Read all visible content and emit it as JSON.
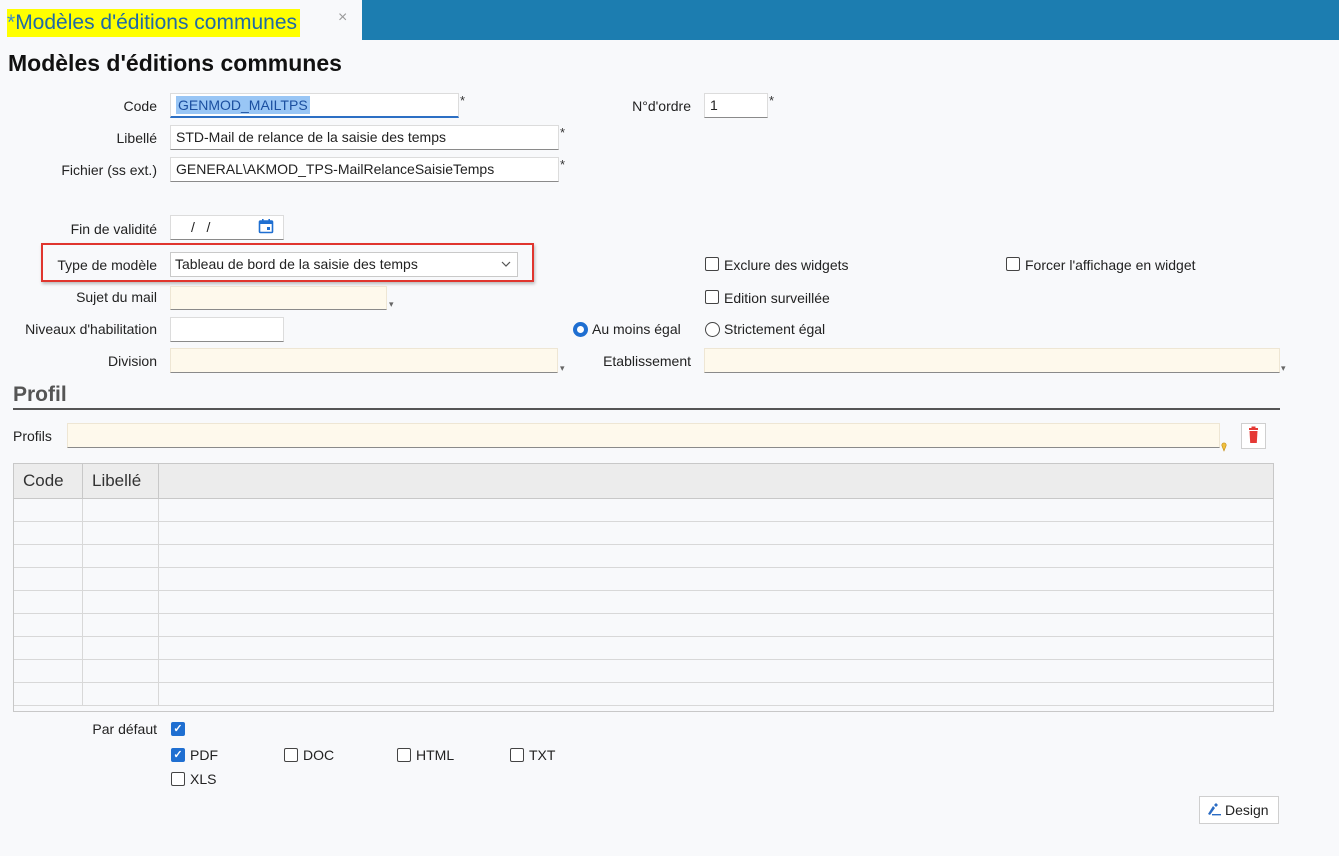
{
  "tab": {
    "modified_mark": "*",
    "title": "Modèles d'éditions communes",
    "close": "×"
  },
  "page_title": "Modèles d'éditions communes",
  "form": {
    "code": {
      "label": "Code",
      "value": "GENMOD_MAILTPS",
      "required": "*"
    },
    "ordre": {
      "label": "N°d'ordre",
      "value": "1",
      "required": "*"
    },
    "libelle": {
      "label": "Libellé",
      "value": "STD-Mail de relance de la saisie des temps",
      "required": "*"
    },
    "fichier": {
      "label": "Fichier (ss ext.)",
      "value": "GENERAL\\AKMOD_TPS-MailRelanceSaisieTemps",
      "required": "*"
    },
    "fin_validite": {
      "label": "Fin de validité",
      "value": "/   /"
    },
    "type_modele": {
      "label": "Type de modèle",
      "value": "Tableau de bord de la saisie des temps"
    },
    "sujet_mail": {
      "label": "Sujet du mail",
      "value": ""
    },
    "niveaux": {
      "label": "Niveaux d'habilitation",
      "value": ""
    },
    "division": {
      "label": "Division",
      "value": ""
    },
    "etablissement": {
      "label": "Etablissement",
      "value": ""
    },
    "exclure_widgets": {
      "label": "Exclure des widgets",
      "checked": false
    },
    "forcer_widget": {
      "label": "Forcer l'affichage en widget",
      "checked": false
    },
    "edition_surveillee": {
      "label": "Edition surveillée",
      "checked": false
    },
    "au_moins_egal": {
      "label": "Au moins égal",
      "selected": true
    },
    "strictement_egal": {
      "label": "Strictement égal",
      "selected": false
    }
  },
  "profil": {
    "section_title": "Profil",
    "profils_label": "Profils",
    "profils_value": "",
    "grid_columns": [
      "Code",
      "Libellé"
    ],
    "grid_rows": 9
  },
  "defaults": {
    "par_defaut_label": "Par défaut",
    "par_defaut_checked": true,
    "formats": [
      {
        "label": "PDF",
        "checked": true
      },
      {
        "label": "DOC",
        "checked": false
      },
      {
        "label": "HTML",
        "checked": false
      },
      {
        "label": "TXT",
        "checked": false
      },
      {
        "label": "XLS",
        "checked": false
      }
    ]
  },
  "design_button": "Design",
  "colors": {
    "tabbar": "#1c7db0",
    "highlight": "#e0352e",
    "accent": "#1f6fd1",
    "tab_highlight": "#ffff00"
  }
}
